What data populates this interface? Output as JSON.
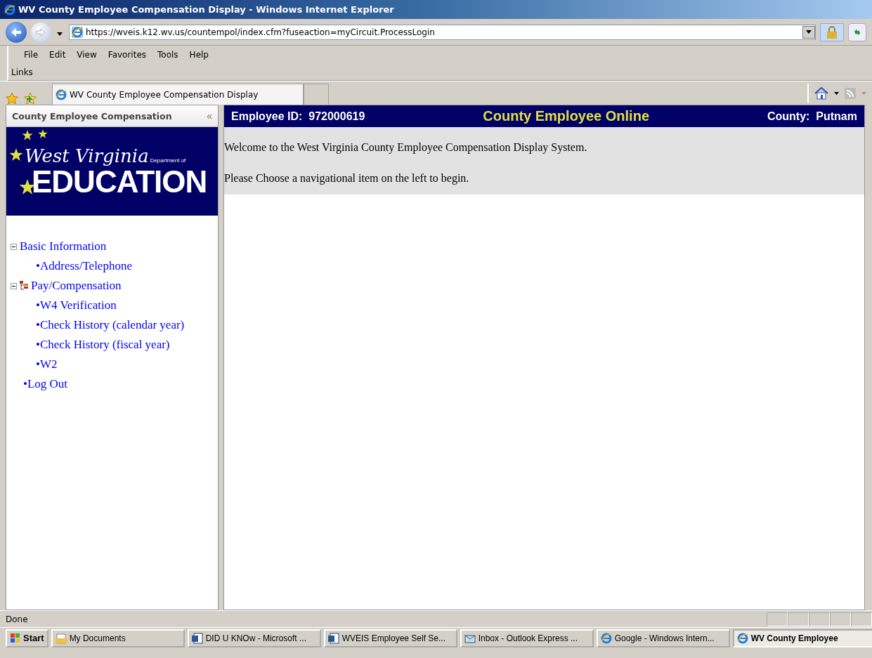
{
  "window": {
    "title": "WV County Employee Compensation Display - Windows Internet Explorer"
  },
  "address_bar": {
    "url": "https://wveis.k12.wv.us/countempol/index.cfm?fuseaction=myCircuit.ProcessLogin"
  },
  "menu": [
    "File",
    "Edit",
    "View",
    "Favorites",
    "Tools",
    "Help"
  ],
  "links_bar": {
    "label": "Links"
  },
  "tabs": [
    {
      "label": "WV County Employee Compensation Display",
      "selected": true
    }
  ],
  "sidebar": {
    "title": "County Employee Compensation",
    "collapse": "«",
    "logo": {
      "script": "West Virginia",
      "small": "Department of",
      "big": "EDUCATION"
    },
    "items": [
      {
        "label": "Basic Information",
        "kind": "folder",
        "expanded": true,
        "children": [
          {
            "label": "•Address/Telephone"
          }
        ]
      },
      {
        "label": "Pay/Compensation",
        "kind": "tree",
        "expanded": true,
        "children": [
          {
            "label": "•W4 Verification"
          },
          {
            "label": "•Check History (calendar year)"
          },
          {
            "label": "•Check History (fiscal year)"
          },
          {
            "label": "•W2"
          }
        ]
      },
      {
        "label": "•Log Out"
      }
    ]
  },
  "header": {
    "employee_id": "Employee ID:  972000619",
    "title": "County Employee Online",
    "county": "County:  Putnam"
  },
  "messages": [
    "Welcome to the West Virginia County Employee Compensation Display System.",
    "Please Choose a navigational item on the left to begin."
  ],
  "status_bar": {
    "text": "Done"
  },
  "taskbar": {
    "start": "Start",
    "items": [
      {
        "label": "My Documents",
        "kind": "folder",
        "selected": false
      },
      {
        "label": "DID U KNOw - Microsoft ...",
        "kind": "word",
        "selected": false
      },
      {
        "label": "WVEIS Employee Self Se...",
        "kind": "word",
        "selected": false
      },
      {
        "label": "Inbox - Outlook Express ...",
        "kind": "mail",
        "selected": false
      },
      {
        "label": "Google - Windows Intern...",
        "kind": "ie",
        "selected": false
      },
      {
        "label": "WV County Employee",
        "kind": "ie",
        "selected": true
      }
    ]
  }
}
